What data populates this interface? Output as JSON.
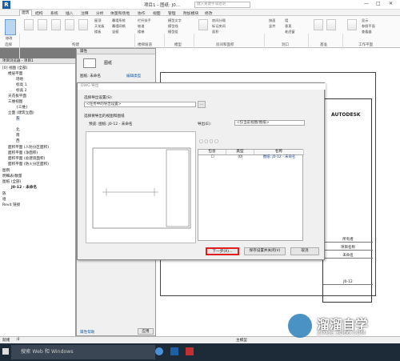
{
  "titlebar": {
    "title": "项目1 - 图纸: J0...",
    "search_placeholder": "键入关键字或短语",
    "min": "—",
    "max": "□",
    "close": "✕"
  },
  "ribbon_tabs": [
    {
      "label": "建筑"
    },
    {
      "label": "结构"
    },
    {
      "label": "系统"
    },
    {
      "label": "插入"
    },
    {
      "label": "注释"
    },
    {
      "label": "分析"
    },
    {
      "label": "体量和场地"
    },
    {
      "label": "协作"
    },
    {
      "label": "视图"
    },
    {
      "label": "管理"
    },
    {
      "label": "附加模块"
    },
    {
      "label": "修改"
    }
  ],
  "ribbon": {
    "small_buttons": [
      "墙",
      "门",
      "窗",
      "构件",
      "柱",
      "屋顶",
      "天花板",
      "楼板",
      "幕墙系统",
      "幕墙网格",
      "竖梃",
      "栏杆扶手",
      "坡道",
      "楼梯",
      "模型文字",
      "模型线",
      "模型组",
      "房间",
      "房间分隔",
      "标记房间",
      "面积",
      "按面",
      "竖井",
      "墙",
      "垂直",
      "老虎窗",
      "标高",
      "轴网",
      "设置",
      "显示",
      "参照平面",
      "查看器"
    ],
    "panels": [
      "选择",
      "构建",
      "楼梯坡道",
      "模型",
      "房间和面积",
      "洞口",
      "基准",
      "工作平面"
    ],
    "select_label": "修改"
  },
  "properties": {
    "header": "属性",
    "type": "图纸",
    "sheet_label": "图纸: 未命名",
    "edit_type": "编辑类型",
    "help": "属性帮助",
    "apply": "应用"
  },
  "browser": {
    "header": "项目浏览器 - 项目1",
    "items": [
      "[0] 视图 (全部)",
      "楼层平面",
      "场地",
      "标高 1",
      "标高 2",
      "天花板平面",
      "三维视图",
      "{三维}",
      "立面 (建筑立面)",
      "东",
      "北",
      "南",
      "西",
      "面积平面 (人防分区面积)",
      "面积平面 (净面积)",
      "面积平面 (总建筑面积)",
      "面积平面 (防火分区面积)",
      "图例",
      "明细表/数量",
      "图纸 (全部)",
      "J0-12 - 未命名",
      "族",
      "组",
      "Revit 链接"
    ]
  },
  "dialog": {
    "title": "DWG 导出",
    "export_setup_label": "选择导出设置(S):",
    "export_setup_value": "<任务中的导出设置>",
    "browse": "...",
    "views_label": "选择要导出的视图和图纸",
    "preview_label": "预览: 图纸: J0-12 - 未命名",
    "export_label": "导出(E):",
    "export_value": "<仅当前视图/图纸>",
    "table_headers": [
      "包含",
      "类型",
      "名称"
    ],
    "table_rows": [
      {
        "include": "☐",
        "type": "(0)",
        "name": "图纸: J0-12 - 未命名"
      }
    ],
    "next": "下一步(X)...",
    "save_close": "保存设置并关闭(V)",
    "cancel": "取消"
  },
  "sheet": {
    "brand": "AUTODESK",
    "owner": "所有者",
    "project": "项目名称",
    "unnamed": "未命名",
    "number": "J0-12"
  },
  "statusbar": {
    "text": "就绪",
    "scale": ":0",
    "model": "主模型"
  },
  "taskbar": {
    "search": "搜索 Web 和 Windows"
  },
  "watermark": {
    "brand": "溜溜自学",
    "url": "ZIXUE.3D66.COM"
  }
}
